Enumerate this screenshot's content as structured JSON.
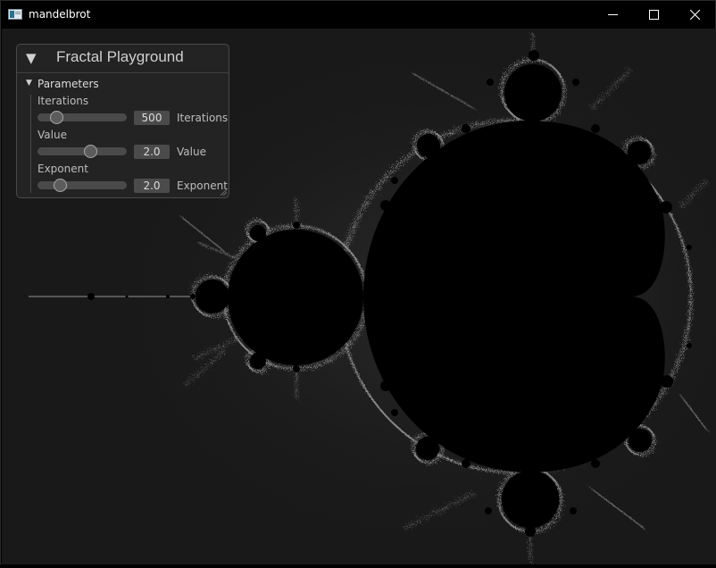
{
  "window": {
    "title": "mandelbrot",
    "controls": {
      "minimize_icon": "minimize-icon",
      "maximize_icon": "maximize-icon",
      "close_icon": "close-icon"
    }
  },
  "colors": {
    "background": "#191919",
    "set_interior": "#000000",
    "panel_bg": "#252525",
    "panel_border": "#4a4a4a",
    "text": "#d8d8d8"
  },
  "panel": {
    "title": "Fractal Playground",
    "collapse_icon": "triangle-down-icon",
    "section": {
      "label": "Parameters",
      "arrow_icon": "triangle-down-icon"
    },
    "params": [
      {
        "label": "Iterations",
        "value": "500",
        "suffix": "Iterations",
        "position": 0.22
      },
      {
        "label": "Value",
        "value": "2.0",
        "suffix": "Value",
        "position": 0.6
      },
      {
        "label": "Exponent",
        "value": "2.0",
        "suffix": "Exponent",
        "position": 0.26
      }
    ]
  }
}
